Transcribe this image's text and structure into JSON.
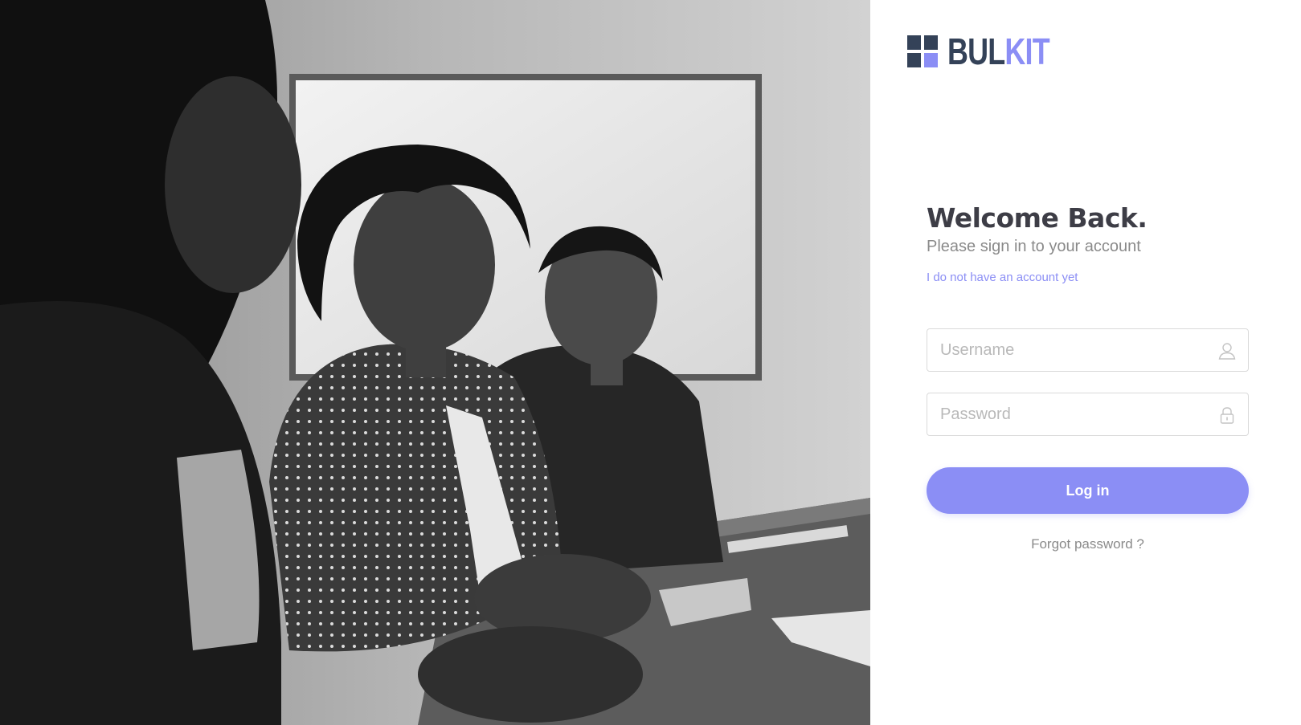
{
  "hero": {
    "image": "grayscale-photo-women-at-meeting-table"
  },
  "brand": {
    "name_part1": "BUL",
    "name_part2": "KIT",
    "icon": "grid-logo-icon"
  },
  "login": {
    "title": "Welcome Back.",
    "subtitle": "Please sign in to your account",
    "signup_link": "I do not have an account yet",
    "username_placeholder": "Username",
    "username_icon": "user-icon",
    "password_placeholder": "Password",
    "password_icon": "lock-icon",
    "submit_label": "Log in",
    "forgot_link": "Forgot password ?"
  },
  "colors": {
    "accent": "#8b8ef5",
    "brand_dark": "#344258",
    "heading": "#3d3d46",
    "muted_text": "#8a8a8a",
    "input_border": "#dadada"
  }
}
